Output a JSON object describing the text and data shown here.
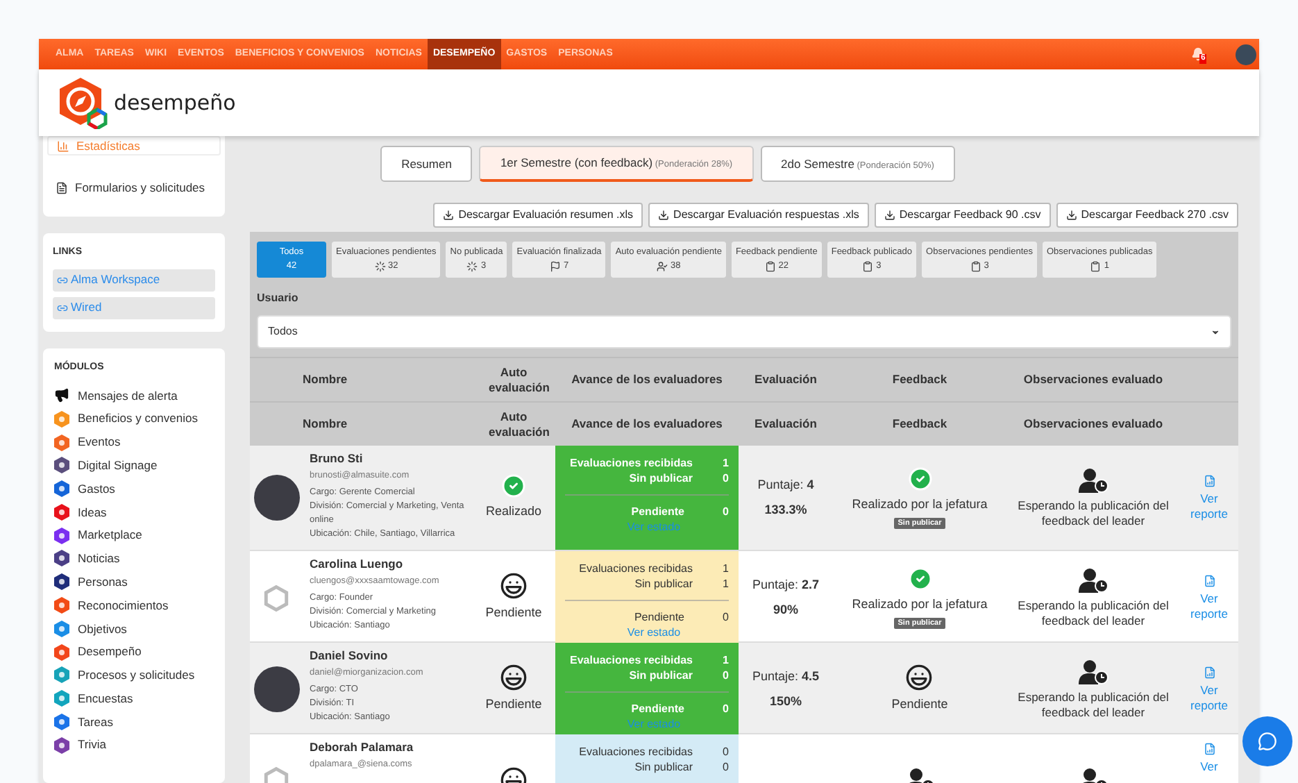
{
  "nav": {
    "items": [
      {
        "label": "ALMA",
        "selected": false
      },
      {
        "label": "TAREAS",
        "selected": false
      },
      {
        "label": "WIKI",
        "selected": false
      },
      {
        "label": "EVENTOS",
        "selected": false
      },
      {
        "label": "BENEFICIOS Y CONVENIOS",
        "selected": false
      },
      {
        "label": "NOTICIAS",
        "selected": false
      },
      {
        "label": "DESEMPEÑO",
        "selected": true
      },
      {
        "label": "GASTOS",
        "selected": false
      },
      {
        "label": "PERSONAS",
        "selected": false
      }
    ],
    "notifications": "6"
  },
  "header": {
    "title": "desempeño"
  },
  "sidebar": {
    "top_items": [
      {
        "label": "Estadísticas",
        "selected": true
      },
      {
        "label": "Formularios y solicitudes",
        "selected": false
      }
    ],
    "links": {
      "title": "LINKS",
      "items": [
        "Alma Workspace",
        "Wired"
      ]
    },
    "modules": {
      "title": "MÓDULOS",
      "items": [
        {
          "label": "Mensajes de alerta",
          "kind": "megaphone",
          "color": "#111111"
        },
        {
          "label": "Beneficios y convenios",
          "kind": "hex",
          "color": "#f7931e"
        },
        {
          "label": "Eventos",
          "kind": "hex",
          "color": "#f26522"
        },
        {
          "label": "Digital Signage",
          "kind": "hex",
          "color": "#5b4f7d"
        },
        {
          "label": "Gastos",
          "kind": "hex",
          "color": "#1565d8"
        },
        {
          "label": "Ideas",
          "kind": "hex",
          "color": "#e8111b"
        },
        {
          "label": "Marketplace",
          "kind": "hex",
          "color": "#7b2ff0"
        },
        {
          "label": "Noticias",
          "kind": "hex",
          "color": "#4b3f86"
        },
        {
          "label": "Personas",
          "kind": "hex",
          "color": "#1f2d7a"
        },
        {
          "label": "Reconocimientos",
          "kind": "hex",
          "color": "#f24b16"
        },
        {
          "label": "Objetivos",
          "kind": "hex",
          "color": "#1a8ee6"
        },
        {
          "label": "Desempeño",
          "kind": "hex",
          "color": "#f2461b"
        },
        {
          "label": "Procesos y solicitudes",
          "kind": "hex",
          "color": "#17a3b8"
        },
        {
          "label": "Encuestas",
          "kind": "hex",
          "color": "#12a5bd"
        },
        {
          "label": "Tareas",
          "kind": "hex",
          "color": "#1a73e8"
        },
        {
          "label": "Trivia",
          "kind": "hex",
          "color": "#7b3fa8"
        }
      ]
    }
  },
  "tabs": [
    {
      "label": "Resumen",
      "selected": false
    },
    {
      "label": "1er Semestre (con feedback)",
      "note": "(Ponderación 28%)",
      "selected": true
    },
    {
      "label": "2do Semestre",
      "note": "(Ponderación 50%)",
      "selected": false
    }
  ],
  "downloads": [
    "Descargar Evaluación resumen .xls",
    "Descargar Evaluación respuestas .xls",
    "Descargar Feedback 90 .csv",
    "Descargar Feedback 270 .csv"
  ],
  "filters": [
    {
      "label": "Todos",
      "count": "42",
      "kind": "none",
      "selected": true
    },
    {
      "label": "Evaluaciones pendientes",
      "count": "32",
      "kind": "spinner",
      "selected": false
    },
    {
      "label": "No publicada",
      "count": "3",
      "kind": "spinner",
      "selected": false
    },
    {
      "label": "Evaluación finalizada",
      "count": "7",
      "kind": "flag",
      "selected": false
    },
    {
      "label": "Auto evaluación pendiente",
      "count": "38",
      "kind": "user",
      "selected": false
    },
    {
      "label": "Feedback pendiente",
      "count": "22",
      "kind": "clipboard",
      "selected": false
    },
    {
      "label": "Feedback publicado",
      "count": "3",
      "kind": "clipboard",
      "selected": false
    },
    {
      "label": "Observaciones pendientes",
      "count": "3",
      "kind": "clipboard",
      "selected": false
    },
    {
      "label": "Observaciones publicadas",
      "count": "1",
      "kind": "clipboard",
      "selected": false
    }
  ],
  "user_filter": {
    "label": "Usuario",
    "value": "Todos"
  },
  "table": {
    "header_rows": [
      [
        "Nombre",
        "Auto evaluación",
        "Avance de los evaluadores",
        "Evaluación",
        "Feedback",
        "Observaciones evaluado"
      ],
      [
        "Nombre",
        "Auto evaluación",
        "Avance de los evaluadores",
        "Evaluación",
        "Feedback",
        "Observaciones evaluado"
      ]
    ],
    "rows": [
      {
        "has_photo": true,
        "name": "Bruno Sti",
        "email": "brunosti@almasuite.com",
        "details": [
          "Cargo: Gerente Comercial",
          "División: Comercial y Marketing, Venta online",
          "Ubicación: Chile, Santiago, Villarrica"
        ],
        "auto": {
          "kind": "done",
          "label": "Realizado"
        },
        "progress": {
          "kind": "complete",
          "lines": [
            {
              "label": "Evaluaciones recibidas",
              "value": "1"
            },
            {
              "label": "Sin publicar",
              "value": "0"
            }
          ],
          "pending": {
            "label": "Pendiente",
            "value": "0"
          },
          "link": "Ver estado"
        },
        "evaluation": {
          "label": "Puntaje:",
          "score": "4",
          "percent": "133.3%"
        },
        "feedback": {
          "kind": "done",
          "label": "Realizado por la jefatura",
          "badge": "Sin publicar"
        },
        "observations": "Esperando la publicación del feedback del leader",
        "report": "Ver reporte"
      },
      {
        "has_photo": false,
        "name": "Carolina Luengo",
        "email": "cluengos@xxxsaamtowage.com",
        "details": [
          "Cargo: Founder",
          "División: Comercial y Marketing",
          "Ubicación: Santiago"
        ],
        "auto": {
          "kind": "pending",
          "label": "Pendiente"
        },
        "progress": {
          "kind": "partial",
          "lines": [
            {
              "label": "Evaluaciones recibidas",
              "value": "1"
            },
            {
              "label": "Sin publicar",
              "value": "1"
            }
          ],
          "pending": {
            "label": "Pendiente",
            "value": "0"
          },
          "link": "Ver estado"
        },
        "evaluation": {
          "label": "Puntaje:",
          "score": "2.7",
          "percent": "90%"
        },
        "feedback": {
          "kind": "done",
          "label": "Realizado por la jefatura",
          "badge": "Sin publicar"
        },
        "observations": "Esperando la publicación del feedback del leader",
        "report": "Ver reporte"
      },
      {
        "has_photo": true,
        "name": "Daniel Sovino",
        "email": "daniel@miorganizacion.com",
        "details": [
          "Cargo: CTO",
          "División: TI",
          "Ubicación: Santiago"
        ],
        "auto": {
          "kind": "pending",
          "label": "Pendiente"
        },
        "progress": {
          "kind": "complete",
          "lines": [
            {
              "label": "Evaluaciones recibidas",
              "value": "1"
            },
            {
              "label": "Sin publicar",
              "value": "0"
            }
          ],
          "pending": {
            "label": "Pendiente",
            "value": "0"
          },
          "link": "Ver estado"
        },
        "evaluation": {
          "label": "Puntaje:",
          "score": "4.5",
          "percent": "150%"
        },
        "feedback": {
          "kind": "pending",
          "label": "Pendiente"
        },
        "observations": "Esperando la publicación del feedback del leader",
        "report": "Ver reporte"
      },
      {
        "has_photo": false,
        "name": "Deborah Palamara",
        "email": "dpalamara_@siena.coms",
        "details": [],
        "auto": {
          "kind": "pending"
        },
        "progress": {
          "kind": "none",
          "lines": [
            {
              "label": "Evaluaciones recibidas",
              "value": "0"
            },
            {
              "label": "Sin publicar",
              "value": "0"
            }
          ]
        },
        "feedback": {
          "kind": "waiting"
        },
        "observations_icon": true,
        "report": "Ver"
      }
    ]
  }
}
